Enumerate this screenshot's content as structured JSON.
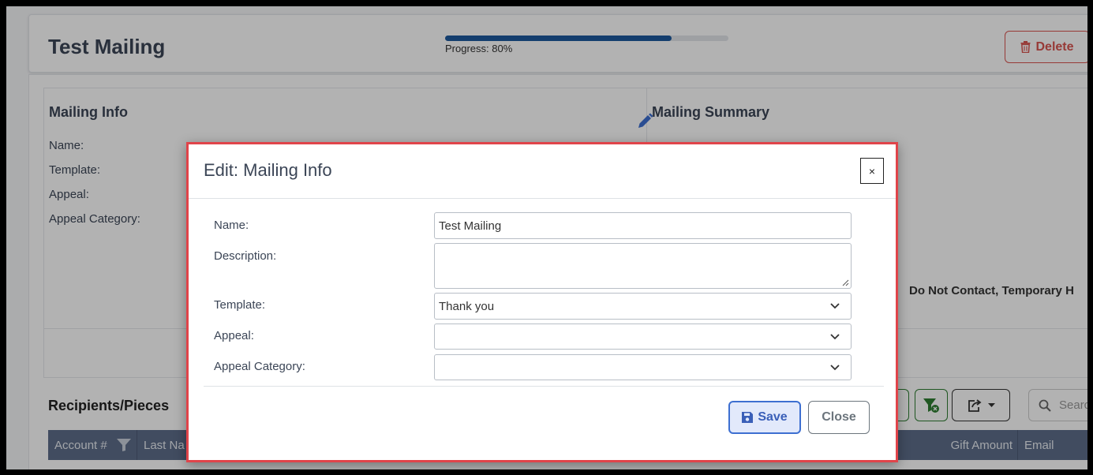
{
  "header": {
    "title": "Test Mailing",
    "progress": {
      "percent": 80,
      "label": "Progress: 80%"
    },
    "delete_label": "Delete"
  },
  "mailing_info": {
    "title": "Mailing Info",
    "fields": [
      "Name:",
      "Template:",
      "Appeal:",
      "Appeal Category:"
    ]
  },
  "mailing_summary": {
    "title": "Mailing Summary",
    "contact_flags_text": "Do Not Contact, Temporary H"
  },
  "recipients": {
    "title": "Recipients/Pieces",
    "search_placeholder": "Search",
    "columns": [
      "Account #",
      "Last Na",
      "Gift Amount",
      "Email"
    ]
  },
  "modal": {
    "title": "Edit: Mailing Info",
    "close_x": "×",
    "fields": {
      "name": {
        "label": "Name:",
        "value": "Test Mailing"
      },
      "description": {
        "label": "Description:",
        "value": ""
      },
      "template": {
        "label": "Template:",
        "value": "Thank you"
      },
      "appeal": {
        "label": "Appeal:",
        "value": ""
      },
      "appeal_category": {
        "label": "Appeal Category:",
        "value": ""
      }
    },
    "save_label": "Save",
    "close_label": "Close"
  },
  "colors": {
    "accent": "#3d6fd1",
    "progress": "#1e5a9e",
    "danger": "#d9534f",
    "success": "#2e7d32",
    "modal_border": "#e0444a"
  },
  "icons": [
    "trash-icon",
    "pencil-icon",
    "filter-icon",
    "filter-clear-icon",
    "export-icon",
    "search-icon",
    "floppy-disk-icon",
    "chevron-down-icon"
  ]
}
